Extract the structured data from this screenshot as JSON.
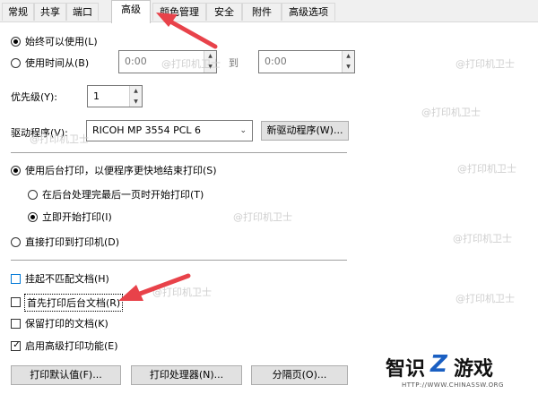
{
  "tabs": [
    "常规",
    "共享",
    "端口",
    "高级",
    "颜色管理",
    "安全",
    "附件",
    "高级选项"
  ],
  "availability": {
    "always_label": "始终可以使用(L)",
    "from_label": "使用时间从(B)",
    "time_from": "0:00",
    "to_label": "到",
    "time_to": "0:00"
  },
  "priority": {
    "label": "优先级(Y):",
    "value": "1"
  },
  "driver": {
    "label": "驱动程序(V):",
    "selected": "RICOH MP 3554 PCL 6",
    "new_driver_button": "新驱动程序(W)..."
  },
  "spool": {
    "spool_label": "使用后台打印，以便程序更快地结束打印(S)",
    "after_last_page_label": "在后台处理完最后一页时开始打印(T)",
    "immediately_label": "立即开始打印(I)",
    "direct_label": "直接打印到打印机(D)"
  },
  "options": {
    "hold_mismatched": "挂起不匹配文档(H)",
    "print_spooled_first": "首先打印后台文档(R)",
    "keep_printed": "保留打印的文档(K)",
    "enable_advanced": "启用高级打印功能(E)"
  },
  "buttons": {
    "defaults": "打印默认值(F)...",
    "processor": "打印处理器(N)...",
    "separator_page": "分隔页(O)..."
  },
  "watermark": {
    "text": "@打印机卫士",
    "brand_a": "智识",
    "brand_b": "游戏",
    "url": "HTTP://WWW.CHINASSW.ORG"
  },
  "colors": {
    "arrow": "#e8424a",
    "focus": "#0078d7"
  }
}
